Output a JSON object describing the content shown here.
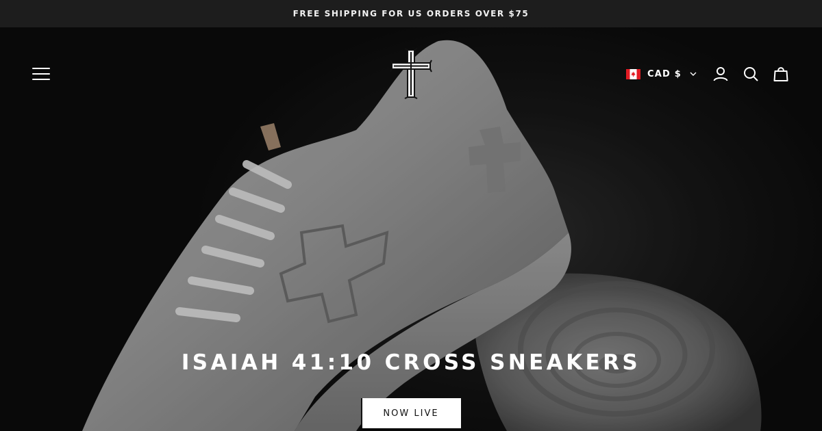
{
  "announcement": {
    "text": "FREE SHIPPING FOR US ORDERS OVER $75"
  },
  "header": {
    "menu_icon": "hamburger-menu-icon",
    "logo_icon": "cross-logo-icon",
    "currency": {
      "label": "CAD $",
      "flag_icon": "canada-flag-icon",
      "chevron_icon": "chevron-down-icon"
    },
    "account_icon": "account-icon",
    "search_icon": "search-icon",
    "cart_icon": "shopping-bag-icon"
  },
  "hero": {
    "image_icon": "white-sneaker-image",
    "headline": "ISAIAH 41:10 CROSS SNEAKERS",
    "cta_label": "NOW LIVE"
  },
  "colors": {
    "announcement_bg": "#1d1d1d",
    "hero_bg": "#0c0c0c",
    "text": "#ffffff",
    "button_bg": "#ffffff",
    "button_text": "#111111"
  }
}
